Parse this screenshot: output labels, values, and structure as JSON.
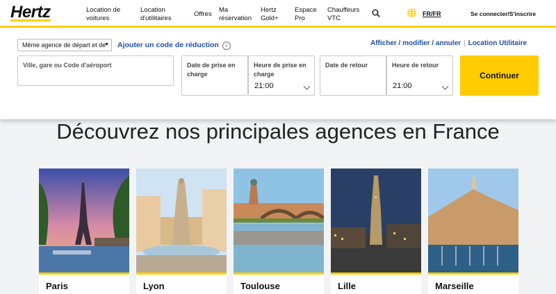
{
  "header": {
    "logo": "Hertz",
    "nav": [
      {
        "label": "Location de\nvoitures"
      },
      {
        "label": "Location\nd'utilitaires"
      },
      {
        "label": "Offres"
      },
      {
        "label": "Ma\nréservation"
      },
      {
        "label": "Hertz\nGold+"
      },
      {
        "label": "Espace\nPro"
      },
      {
        "label": "Chauffeurs\nVTC"
      }
    ],
    "search_icon": "search-icon",
    "globe_icon": "globe-icon",
    "language": "FR/FR",
    "account": "Se connecter/S'inscrire"
  },
  "booking": {
    "agency_select": "Même agence de départ et de",
    "promo_link": "Ajouter un code de réduction",
    "links": [
      "Afficher / modifier / annuler",
      "Location Utilitaire"
    ],
    "location_placeholder": "Ville, gare ou Code d'aéroport",
    "pickup_date_label": "Date de prise en charge",
    "pickup_time_label": "Heure de prise en charge",
    "pickup_time": "21:00",
    "return_date_label": "Date de retour",
    "return_time_label": "Heure de retour",
    "return_time": "21:00",
    "continue_label": "Continuer"
  },
  "main": {
    "heading": "Découvrez nos principales agences en France",
    "cities": [
      {
        "name": "Paris"
      },
      {
        "name": "Lyon"
      },
      {
        "name": "Toulouse"
      },
      {
        "name": "Lille"
      },
      {
        "name": "Marseille"
      }
    ]
  },
  "colors": {
    "accent": "#ffd100",
    "link": "#1f4fa5",
    "button": "#ffcc00"
  }
}
